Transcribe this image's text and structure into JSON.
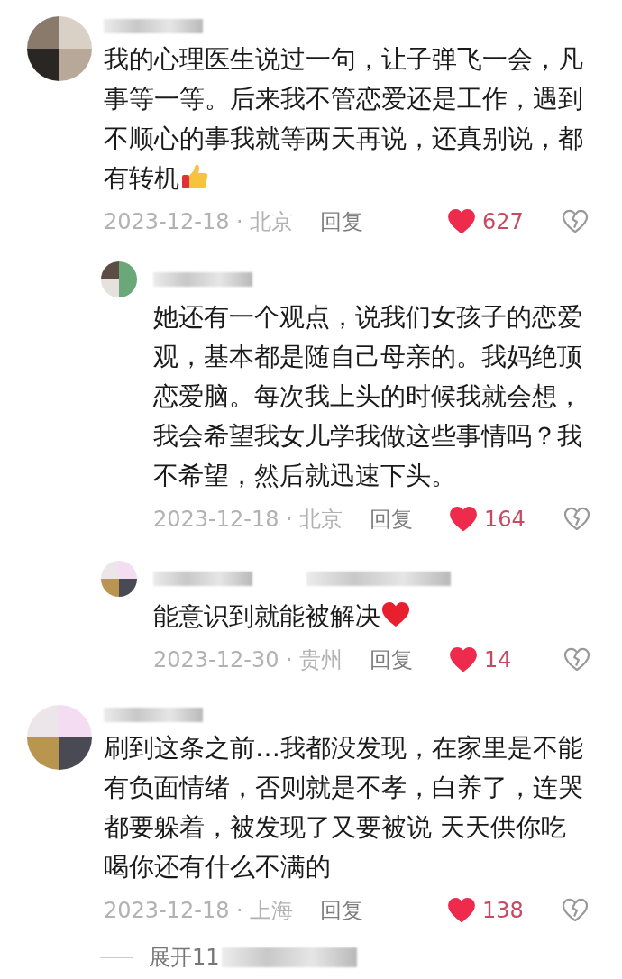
{
  "comments": [
    {
      "text": "我的心理医生说过一句，让子弹飞一会，凡事等一等。后来我不管恋爱还是工作，遇到不顺心的事我就等两天再说，还真别说，都有转机",
      "kind": "thumbs_up",
      "date": "2023-12-18",
      "separator": "·",
      "location": "北京",
      "reply_label": "回复",
      "likes": "627",
      "liked": true,
      "replies": [
        {
          "text": "她还有一个观点，说我们女孩子的恋爱观，基本都是随自己母亲的。我妈绝顶恋爱脑。每次我上头的时候我就会想，我会希望我女儿学我做这些事情吗？我不希望，然后就迅速下头。",
          "kind": "plain",
          "date": "2023-12-18",
          "separator": "·",
          "location": "北京",
          "reply_label": "回复",
          "likes": "164",
          "liked": true
        },
        {
          "text": "能意识到就能被解决",
          "kind": "red_heart",
          "date": "2023-12-30",
          "separator": "·",
          "location": "贵州",
          "reply_label": "回复",
          "likes": "14",
          "liked": true
        }
      ]
    },
    {
      "text": "刷到这条之前…我都没发现，在家里是不能有负面情绪，否则就是不孝，白养了，连哭都要躲着，被发现了又要被说 天天供你吃喝你还有什么不满的",
      "kind": "plain",
      "date": "2023-12-18",
      "separator": "·",
      "location": "上海",
      "reply_label": "回复",
      "likes": "138",
      "liked": true,
      "expand": {
        "label": "展开11"
      }
    }
  ]
}
